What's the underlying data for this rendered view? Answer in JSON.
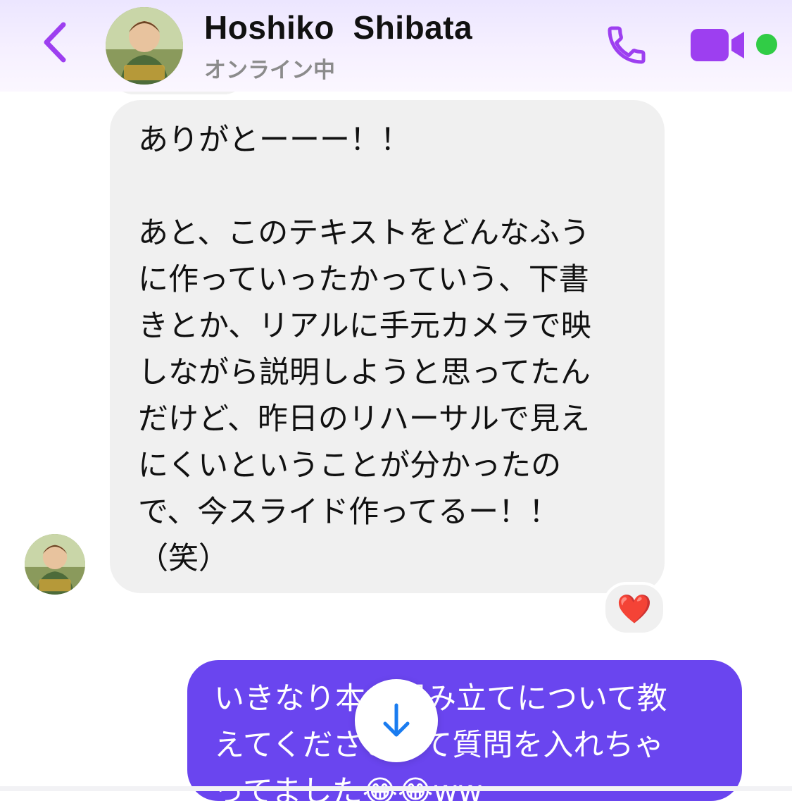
{
  "header": {
    "back_icon": "chevron-left-icon",
    "contact_name": "Hoshiko  Shibata",
    "status": "オンライン中",
    "call_icon": "phone-icon",
    "video_icon": "video-camera-icon",
    "online_indicator_color": "#31cc46",
    "accent_color": "#9d3ff0"
  },
  "messages": [
    {
      "direction": "incoming",
      "text": "ありがとーーー！！\n\nあと、このテキストをどんなふう\nに作っていったかっていう、下書\nきとか、リアルに手元カメラで映\nしながら説明しようと思ってたん\nだけど、昨日のリハーサルで見え\nにくいということが分かったの\nで、今スライド作ってるー！！\n（笑）",
      "reaction": "❤️",
      "bubble_color": "#f0f0f0"
    },
    {
      "direction": "outgoing",
      "text": "いきなり本の組み立てについて教\nえてくださいって質問を入れちゃ\nってました😂😂ww",
      "bubble_color": "#6a45ef"
    }
  ],
  "scroll_button": {
    "icon": "arrow-down-icon",
    "color": "#1a7cf0"
  }
}
